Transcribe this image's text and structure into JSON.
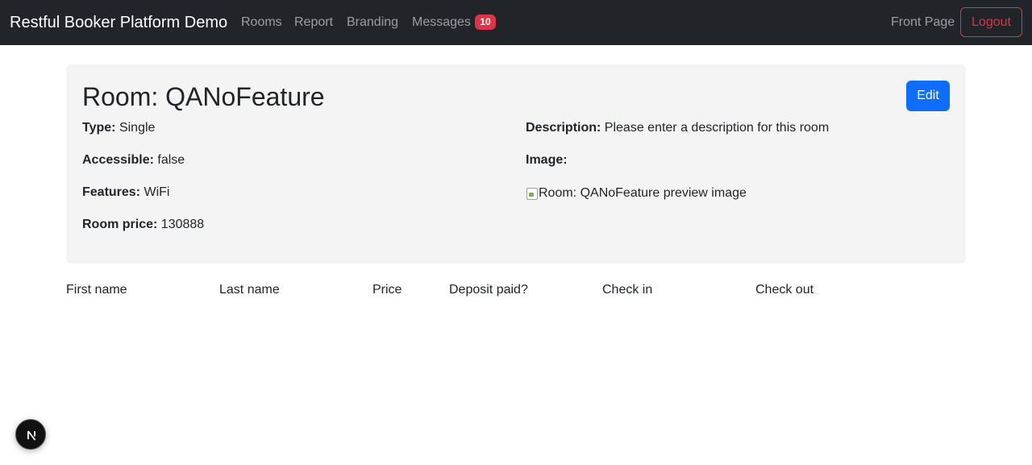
{
  "navbar": {
    "brand": "Restful Booker Platform Demo",
    "links": {
      "rooms": "Rooms",
      "report": "Report",
      "branding": "Branding",
      "messages": "Messages",
      "messages_count": "10"
    },
    "front_page": "Front Page",
    "logout": "Logout"
  },
  "room": {
    "title": "Room: QANoFeature",
    "edit_label": "Edit",
    "type_label": "Type:",
    "type_value": "Single",
    "accessible_label": "Accessible:",
    "accessible_value": "false",
    "features_label": "Features:",
    "features_value": "WiFi",
    "price_label": "Room price:",
    "price_value": "130888",
    "description_label": "Description:",
    "description_value": "Please enter a description for this room",
    "image_label": "Image:",
    "image_alt": "Room: QANoFeature preview image"
  },
  "bookings_table": {
    "headers": [
      "First name",
      "Last name",
      "Price",
      "Deposit paid?",
      "Check in",
      "Check out"
    ]
  },
  "dev_indicator": {
    "icon": "nextjs-logo-icon"
  },
  "colors": {
    "navbar_bg": "#212529",
    "danger": "#dc3545",
    "primary": "#0d6efd",
    "card_bg": "#f4f4f4"
  }
}
